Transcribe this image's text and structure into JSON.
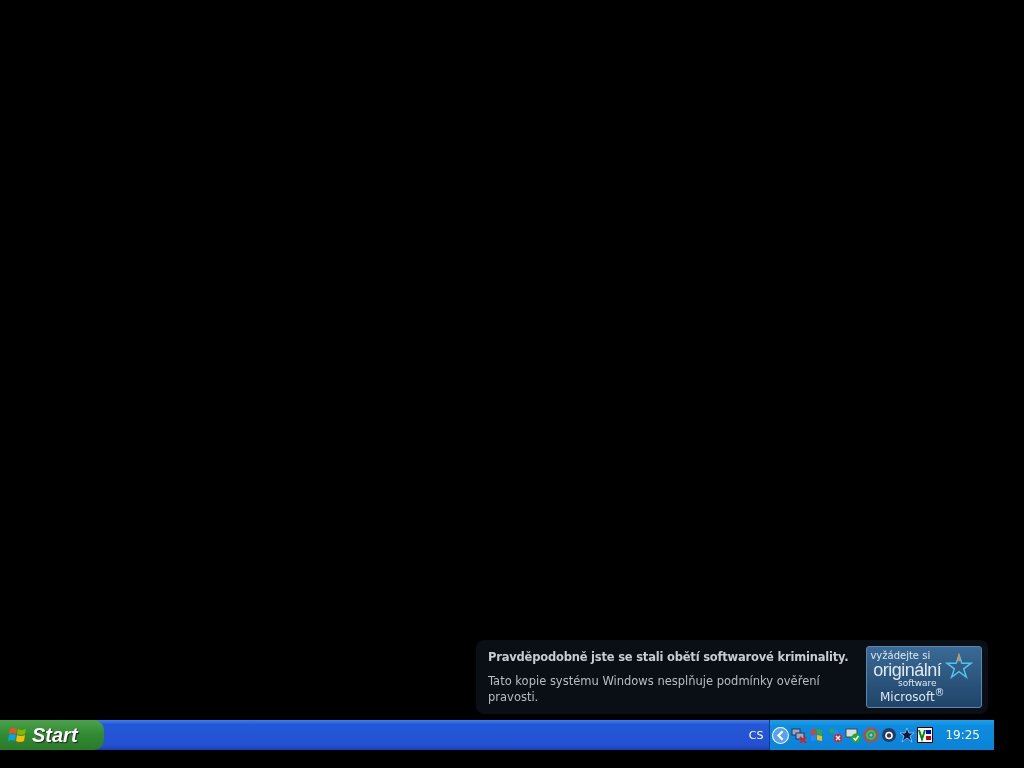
{
  "notification": {
    "title": "Pravděpodobně jste se stali obětí softwarové kriminality.",
    "message": "Tato kopie systému Windows nesplňuje podmínky ověření pravosti.",
    "badge": {
      "line_1": "vyžádejte si",
      "line_2": "originální",
      "line_3": "software",
      "line_4": "Microsoft$^{®}$"
    }
  },
  "taskbar": {
    "start_label": "Start",
    "language": "CS",
    "clock": "19:25"
  }
}
